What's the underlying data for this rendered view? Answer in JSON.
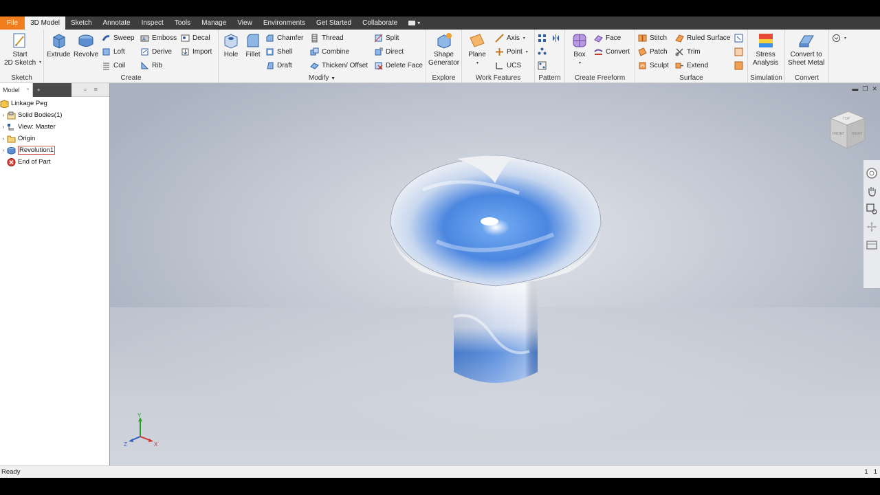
{
  "tabs": [
    {
      "label": "File"
    },
    {
      "label": "3D Model"
    },
    {
      "label": "Sketch"
    },
    {
      "label": "Annotate"
    },
    {
      "label": "Inspect"
    },
    {
      "label": "Tools"
    },
    {
      "label": "Manage"
    },
    {
      "label": "View"
    },
    {
      "label": "Environments"
    },
    {
      "label": "Get Started"
    },
    {
      "label": "Collaborate"
    }
  ],
  "ribbon": {
    "sketch": {
      "panel": "Sketch",
      "start_line1": "Start",
      "start_line2": "2D Sketch"
    },
    "create": {
      "panel": "Create",
      "extrude": "Extrude",
      "revolve": "Revolve",
      "sweep": "Sweep",
      "loft": "Loft",
      "coil": "Coil",
      "emboss": "Emboss",
      "derive": "Derive",
      "rib": "Rib",
      "decal": "Decal",
      "import": "Import"
    },
    "modify": {
      "panel": "Modify",
      "hole": "Hole",
      "fillet": "Fillet",
      "chamfer": "Chamfer",
      "shell": "Shell",
      "draft": "Draft",
      "thread": "Thread",
      "combine": "Combine",
      "thicken": "Thicken/ Offset",
      "split": "Split",
      "direct": "Direct",
      "delete_face": "Delete Face"
    },
    "explore": {
      "panel": "Explore",
      "shape_line1": "Shape",
      "shape_line2": "Generator"
    },
    "work_features": {
      "panel": "Work Features",
      "plane": "Plane",
      "axis": "Axis",
      "point": "Point",
      "ucs": "UCS"
    },
    "pattern": {
      "panel": "Pattern"
    },
    "freeform": {
      "panel": "Create Freeform",
      "box": "Box",
      "face": "Face",
      "convert": "Convert"
    },
    "surface": {
      "panel": "Surface",
      "stitch": "Stitch",
      "patch": "Patch",
      "sculpt": "Sculpt",
      "ruled": "Ruled Surface",
      "trim": "Trim",
      "extend": "Extend"
    },
    "simulation": {
      "panel": "Simulation",
      "stress_line1": "Stress",
      "stress_line2": "Analysis"
    },
    "convert": {
      "panel": "Convert",
      "sheet_line1": "Convert to",
      "sheet_line2": "Sheet Metal"
    }
  },
  "browser": {
    "tab_label": "Model",
    "tab_close": "×",
    "add_label": "+",
    "items": [
      {
        "label": "Linkage Peg",
        "icon": "part-icon"
      },
      {
        "label": "Solid Bodies(1)",
        "icon": "solid-bodies-icon"
      },
      {
        "label": "View: Master",
        "icon": "view-icon"
      },
      {
        "label": "Origin",
        "icon": "folder-icon"
      },
      {
        "label": "Revolution1",
        "icon": "revolve-feature-icon"
      },
      {
        "label": "End of Part",
        "icon": "end-of-part-icon"
      }
    ]
  },
  "viewcube": {
    "top": "TOP",
    "front": "FRONT",
    "right": "RIGHT"
  },
  "triad": {
    "x": "X",
    "y": "Y",
    "z": "Z"
  },
  "status": {
    "left": "Ready",
    "right1": "1",
    "right2": "1"
  },
  "colors": {
    "file_tab": "#f07d1e",
    "tab_bar": "#3c3c3c",
    "part_blue": "#4b86e0"
  }
}
